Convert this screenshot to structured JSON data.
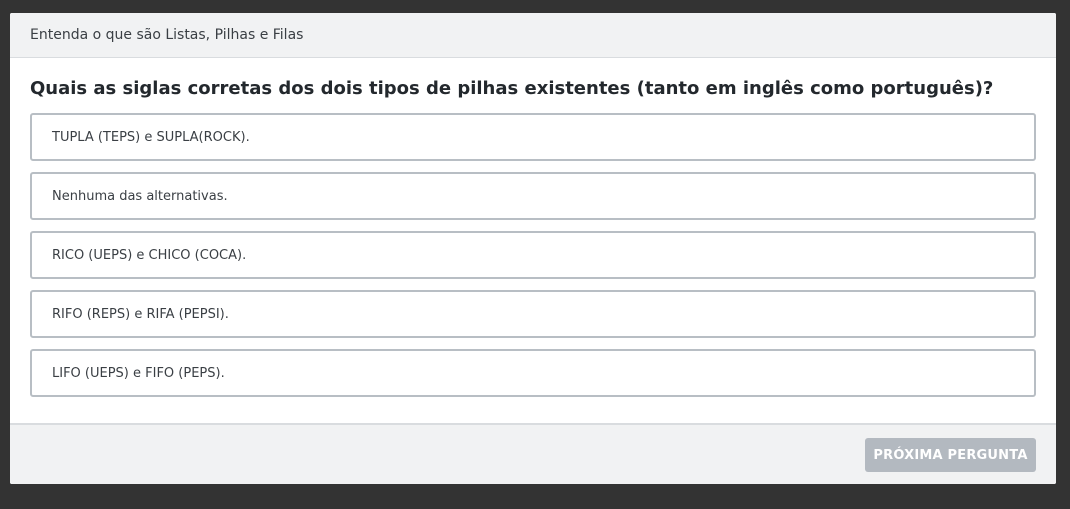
{
  "header": {
    "title": "Entenda o que são Listas, Pilhas e Filas"
  },
  "question": {
    "text": "Quais as siglas corretas dos dois tipos de pilhas existentes (tanto em inglês como português)?"
  },
  "options": [
    {
      "label": "TUPLA (TEPS) e SUPLA(ROCK)."
    },
    {
      "label": "Nenhuma das alternativas."
    },
    {
      "label": "RICO (UEPS) e CHICO (COCA)."
    },
    {
      "label": "RIFO (REPS) e RIFA (PEPSI)."
    },
    {
      "label": "LIFO (UEPS) e FIFO (PEPS)."
    }
  ],
  "footer": {
    "next_label": "PRÓXIMA PERGUNTA",
    "next_enabled": false
  },
  "colors": {
    "backdrop": "#333333",
    "panel": "#ffffff",
    "header_bg": "#f1f2f3",
    "option_border": "#b8bec4",
    "button_disabled": "#b3b9c0"
  }
}
